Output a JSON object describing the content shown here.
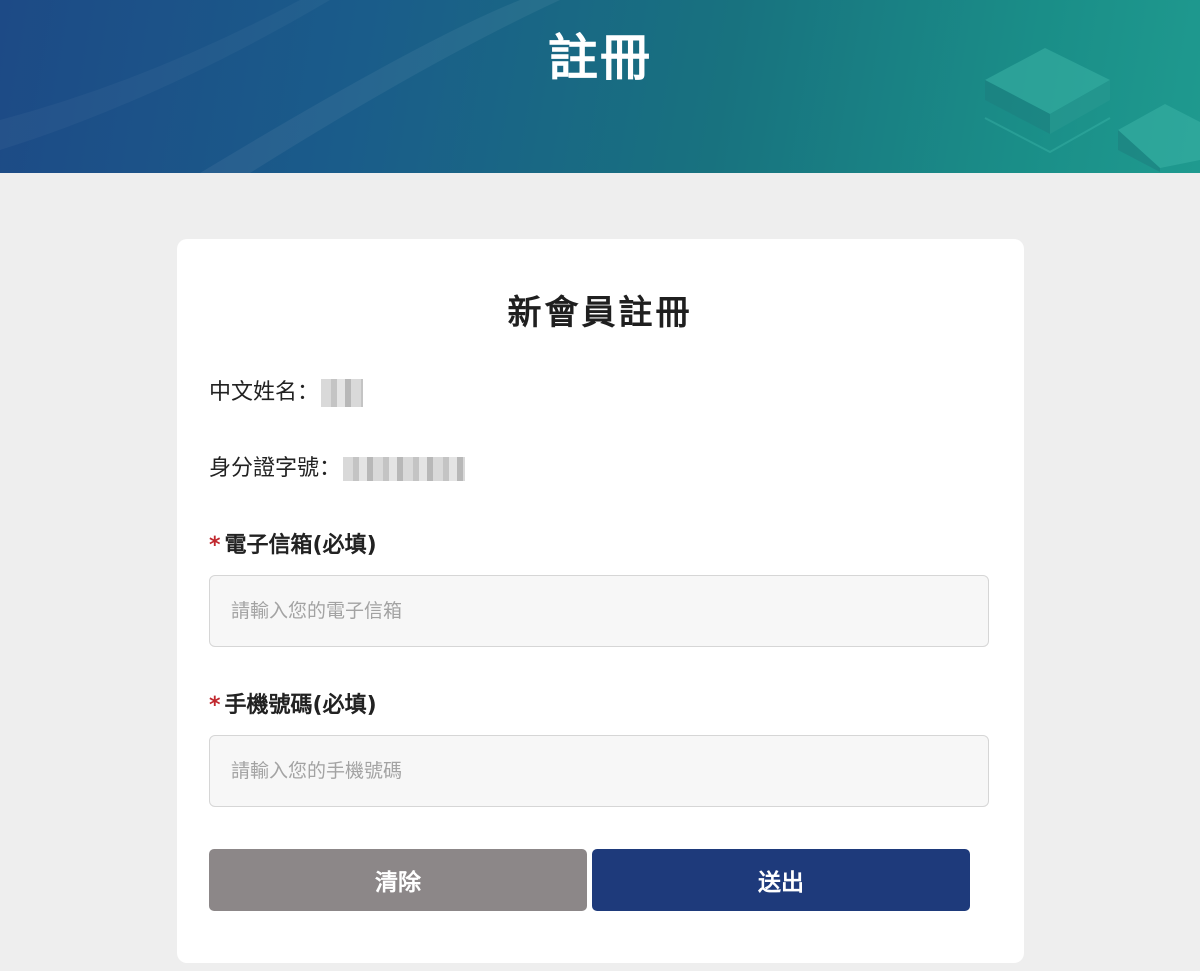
{
  "banner": {
    "title": "註冊"
  },
  "form": {
    "title": "新會員註冊",
    "chinese_name": {
      "label": "中文姓名："
    },
    "id_number": {
      "label": "身分證字號："
    },
    "email": {
      "required_mark": "*",
      "label": "電子信箱(必填)",
      "placeholder": "請輸入您的電子信箱",
      "value": ""
    },
    "phone": {
      "required_mark": "*",
      "label": "手機號碼(必填)",
      "placeholder": "請輸入您的手機號碼",
      "value": ""
    },
    "buttons": {
      "clear": "清除",
      "submit": "送出"
    }
  },
  "colors": {
    "banner_start": "#1d4a86",
    "banner_end": "#1f9a8f",
    "page_background": "#eeeeee",
    "card_background": "#ffffff",
    "required": "#c0272d",
    "clear_button": "#8c8788",
    "submit_button": "#1e3a7b"
  }
}
